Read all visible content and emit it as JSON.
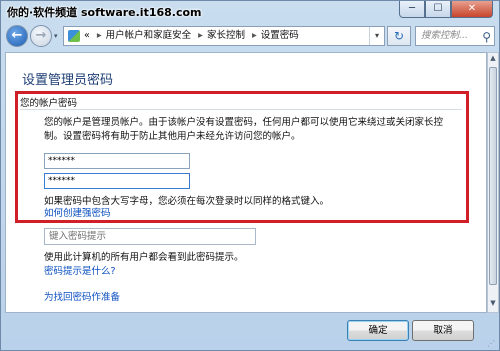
{
  "watermark": "你的·软件频道 software.it168.com",
  "window_controls": {
    "minimize": "─",
    "maximize": "☐",
    "close": "✕"
  },
  "nav": {
    "back_icon": "arrow-left-icon",
    "forward_icon": "arrow-right-icon",
    "recent": "▾",
    "breadcrumb_more": "«",
    "breadcrumbs": [
      "用户帐户和家庭安全",
      "家长控制",
      "设置密码"
    ],
    "refresh_glyph": "↻",
    "search_placeholder": "搜索控制...",
    "search_glyph": "⚲"
  },
  "page": {
    "title": "设置管理员密码",
    "account_heading": "您的帐户密码",
    "description": "您的帐户是管理员帐户。由于该帐户没有设置密码，任何用户都可以使用它来绕过或关闭家长控制。设置密码将有助于防止其他用户未经允许访问您的帐户。",
    "password_value": "******",
    "confirm_value": "******",
    "case_note": "如果密码中包含大写字母，您必须在每次登录时以同样的格式键入。",
    "strong_password_link": "如何创建强密码",
    "hint_placeholder": "键入密码提示",
    "hint_visibility_note": "使用此计算机的所有用户都会看到此密码提示。",
    "what_is_hint_link": "密码提示是什么?",
    "prepare_recovery_link": "为找回密码作准备"
  },
  "buttons": {
    "ok": "确定",
    "cancel": "取消"
  },
  "colors": {
    "highlight_box": "#d11f2a",
    "link": "#0b4fc0",
    "title": "#1e3f75"
  }
}
